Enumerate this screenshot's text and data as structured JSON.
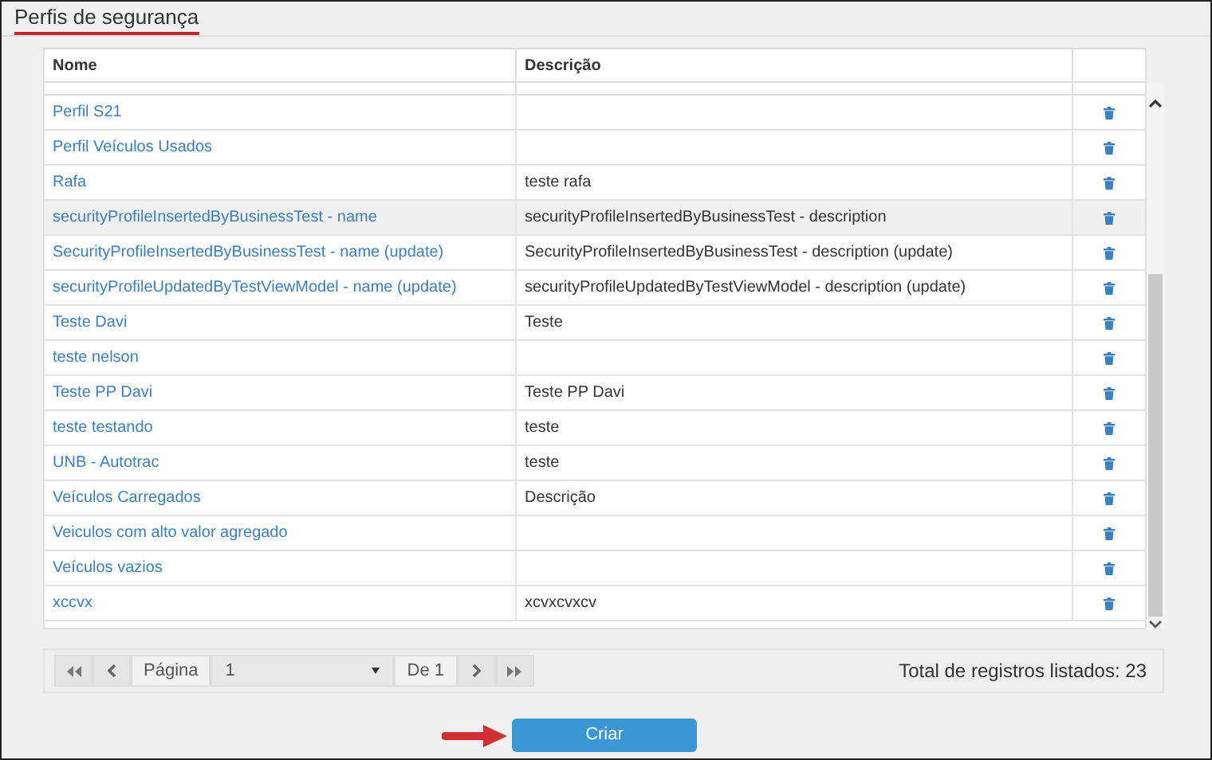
{
  "page_title": "Perfis de segurança",
  "table": {
    "columns": [
      "Nome",
      "Descrição"
    ],
    "rows": [
      {
        "name": "Perfil S21",
        "description": "",
        "highlighted": false
      },
      {
        "name": "Perfil Veículos Usados",
        "description": "",
        "highlighted": false
      },
      {
        "name": "Rafa",
        "description": "teste rafa",
        "highlighted": false
      },
      {
        "name": "securityProfileInsertedByBusinessTest - name",
        "description": "securityProfileInsertedByBusinessTest - description",
        "highlighted": true
      },
      {
        "name": "SecurityProfileInsertedByBusinessTest - name (update)",
        "description": "SecurityProfileInsertedByBusinessTest - description (update)",
        "highlighted": false
      },
      {
        "name": "securityProfileUpdatedByTestViewModel - name (update)",
        "description": "securityProfileUpdatedByTestViewModel - description (update)",
        "highlighted": false
      },
      {
        "name": "Teste Davi",
        "description": "Teste",
        "highlighted": false
      },
      {
        "name": "teste nelson",
        "description": "",
        "highlighted": false
      },
      {
        "name": "Teste PP Davi",
        "description": "Teste PP Davi",
        "highlighted": false
      },
      {
        "name": "teste testando",
        "description": "teste",
        "highlighted": false
      },
      {
        "name": "UNB - Autotrac",
        "description": "teste",
        "highlighted": false
      },
      {
        "name": "Veículos Carregados",
        "description": "Descrição",
        "highlighted": false
      },
      {
        "name": "Veiculos com alto valor agregado",
        "description": "",
        "highlighted": false
      },
      {
        "name": "Veículos vazios",
        "description": "",
        "highlighted": false
      },
      {
        "name": "xccvx",
        "description": "xcvxcvxcv",
        "highlighted": false
      }
    ]
  },
  "pager": {
    "page_label": "Página",
    "page_value": "1",
    "of_label": "De 1",
    "total": "Total de registros listados: 23"
  },
  "create_button": "Criar"
}
